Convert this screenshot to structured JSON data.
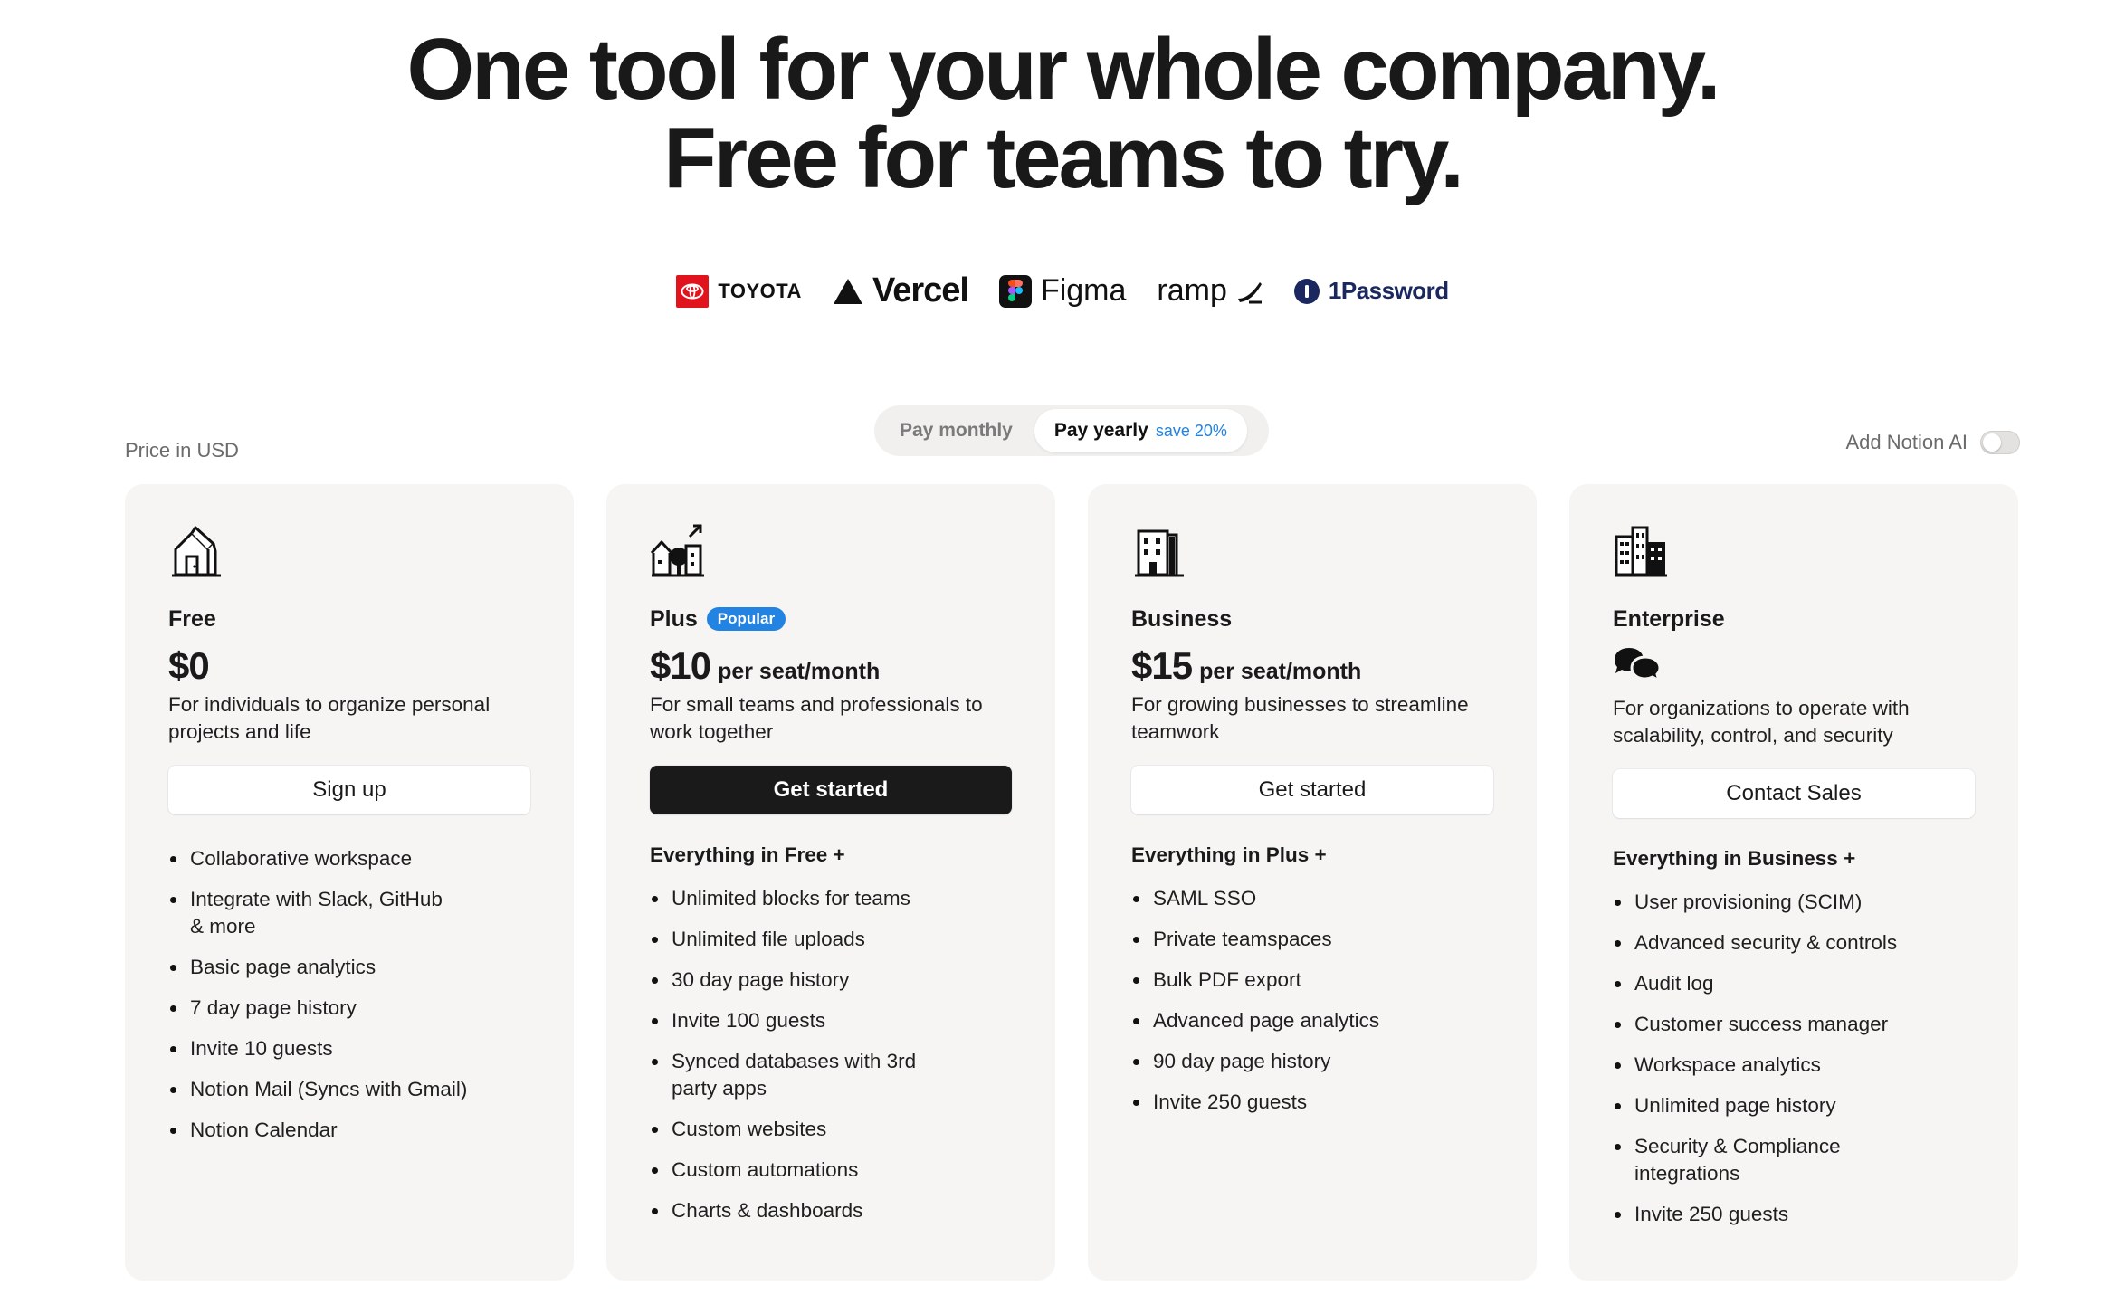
{
  "hero": {
    "line1": "One tool for your whole company.",
    "line2": "Free for teams to try."
  },
  "logos": [
    {
      "name": "TOYOTA"
    },
    {
      "name": "Vercel"
    },
    {
      "name": "Figma"
    },
    {
      "name": "ramp"
    },
    {
      "name": "1Password"
    }
  ],
  "price_note": "Price in USD",
  "billing": {
    "monthly": "Pay monthly",
    "yearly": "Pay yearly",
    "save": "save 20%",
    "selected": "yearly"
  },
  "ai_toggle": {
    "label": "Add Notion AI",
    "on": false
  },
  "plans": [
    {
      "name": "Free",
      "price": "$0",
      "per": "",
      "description": "For individuals to organize personal projects and life",
      "cta": "Sign up",
      "features_header": "",
      "features": [
        "Collaborative workspace",
        "Integrate with Slack, GitHub & more",
        "Basic page analytics",
        "7 day page history",
        "Invite 10 guests",
        "Notion Mail (Syncs with Gmail)",
        "Notion Calendar"
      ]
    },
    {
      "name": "Plus",
      "badge": "Popular",
      "price": "$10",
      "per": "per seat/month",
      "description": "For small teams and professionals to work together",
      "cta": "Get started",
      "features_header": "Everything in Free +",
      "features": [
        "Unlimited blocks for teams",
        "Unlimited file uploads",
        "30 day page history",
        "Invite 100 guests",
        "Synced databases with 3rd party apps",
        "Custom websites",
        "Custom automations",
        "Charts & dashboards"
      ]
    },
    {
      "name": "Business",
      "price": "$15",
      "per": "per seat/month",
      "description": "For growing businesses to streamline teamwork",
      "cta": "Get started",
      "features_header": "Everything in Plus +",
      "features": [
        "SAML SSO",
        "Private teamspaces",
        "Bulk PDF export",
        "Advanced page analytics",
        "90 day page history",
        "Invite 250 guests"
      ]
    },
    {
      "name": "Enterprise",
      "price": "",
      "per": "",
      "description": "For organizations to operate with scalability, control, and security",
      "cta": "Contact Sales",
      "features_header": "Everything in Business +",
      "features": [
        "User provisioning (SCIM)",
        "Advanced security & controls",
        "Audit log",
        "Customer success manager",
        "Workspace analytics",
        "Unlimited page history",
        "Security & Compliance integrations",
        "Invite 250 guests"
      ]
    }
  ],
  "colors": {
    "accent": "#2383e2",
    "card_bg": "#f6f5f4",
    "dark_button": "#1a1a1a",
    "toyota": "#e1141d",
    "onepassword": "#1a285f"
  }
}
